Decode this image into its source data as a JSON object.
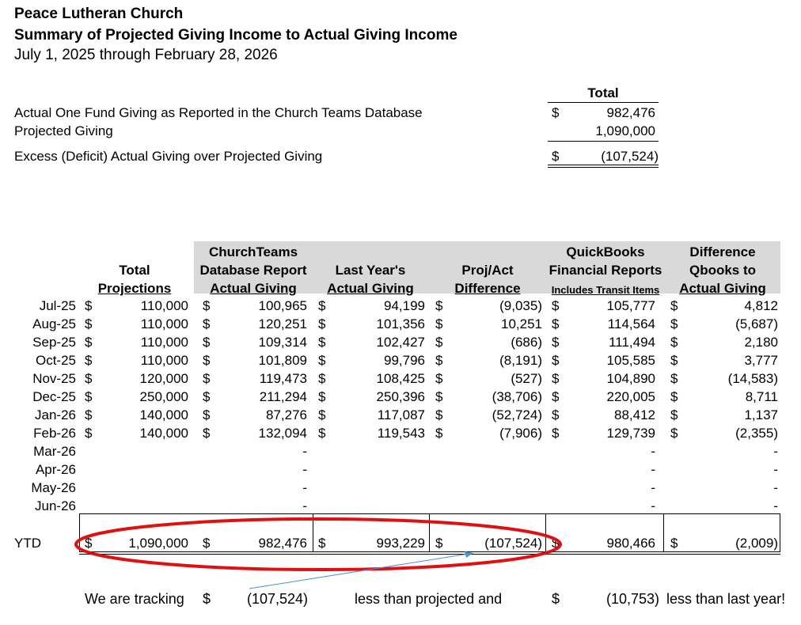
{
  "header": {
    "org": "Peace Lutheran Church",
    "title": "Summary of Projected Giving Income to Actual Giving Income",
    "period": "July 1, 2025 through February 28, 2026"
  },
  "summary": {
    "total_header": "Total",
    "rows": [
      {
        "label": "Actual One Fund Giving as Reported in the Church Teams Database",
        "currency": "$",
        "value": "982,476"
      },
      {
        "label": "Projected Giving",
        "currency": "",
        "value": "1,090,000"
      },
      {
        "label": "Excess (Deficit) Actual Giving over Projected Giving",
        "currency": "$",
        "value": "(107,524)"
      }
    ]
  },
  "table": {
    "headers": {
      "projections": [
        "Total",
        "Projections"
      ],
      "churchteams": [
        "ChurchTeams",
        "Database Report",
        "Actual Giving"
      ],
      "lastyear": [
        "Last Year's",
        "Actual Giving"
      ],
      "projact": [
        "Proj/Act",
        "Difference"
      ],
      "quickbooks": [
        "QuickBooks",
        "Financial Reports",
        "Includes Transit Items"
      ],
      "difference": [
        "Difference",
        "Qbooks to",
        "Actual Giving"
      ]
    },
    "rows": [
      {
        "month": "Jul-25",
        "proj": "110,000",
        "ct": "100,965",
        "ly": "94,199",
        "pa": "(9,035)",
        "qb": "105,777",
        "diff": "4,812"
      },
      {
        "month": "Aug-25",
        "proj": "110,000",
        "ct": "120,251",
        "ly": "101,356",
        "pa": "10,251",
        "qb": "114,564",
        "diff": "(5,687)"
      },
      {
        "month": "Sep-25",
        "proj": "110,000",
        "ct": "109,314",
        "ly": "102,427",
        "pa": "(686)",
        "qb": "111,494",
        "diff": "2,180"
      },
      {
        "month": "Oct-25",
        "proj": "110,000",
        "ct": "101,809",
        "ly": "99,796",
        "pa": "(8,191)",
        "qb": "105,585",
        "diff": "3,777"
      },
      {
        "month": "Nov-25",
        "proj": "120,000",
        "ct": "119,473",
        "ly": "108,425",
        "pa": "(527)",
        "qb": "104,890",
        "diff": "(14,583)"
      },
      {
        "month": "Dec-25",
        "proj": "250,000",
        "ct": "211,294",
        "ly": "250,396",
        "pa": "(38,706)",
        "qb": "220,005",
        "diff": "8,711"
      },
      {
        "month": "Jan-26",
        "proj": "140,000",
        "ct": "87,276",
        "ly": "117,087",
        "pa": "(52,724)",
        "qb": "88,412",
        "diff": "1,137"
      },
      {
        "month": "Feb-26",
        "proj": "140,000",
        "ct": "132,094",
        "ly": "119,543",
        "pa": "(7,906)",
        "qb": "129,739",
        "diff": "(2,355)"
      },
      {
        "month": "Mar-26",
        "proj": "",
        "ct": "-",
        "ly": "",
        "pa": "",
        "qb": "-",
        "diff": "-"
      },
      {
        "month": "Apr-26",
        "proj": "",
        "ct": "-",
        "ly": "",
        "pa": "",
        "qb": "-",
        "diff": "-"
      },
      {
        "month": "May-26",
        "proj": "",
        "ct": "-",
        "ly": "",
        "pa": "",
        "qb": "-",
        "diff": "-"
      },
      {
        "month": "Jun-26",
        "proj": "",
        "ct": "-",
        "ly": "",
        "pa": "",
        "qb": "-",
        "diff": "-"
      }
    ],
    "ytd": {
      "label": "YTD",
      "proj": "1,090,000",
      "ct": "982,476",
      "ly": "993,229",
      "pa": "(107,524)",
      "qb": "980,466",
      "diff": "(2,009)"
    },
    "currency": "$"
  },
  "footer": {
    "tracking": "We are tracking",
    "currency": "$",
    "amount1": "(107,524)",
    "less_projected": "less than projected and",
    "amount2": "(10,753)",
    "less_last_year": "less than last year!"
  },
  "colors": {
    "highlight_ellipse": "#e01010",
    "arrow": "#4a8fd4",
    "header_bg": "#d9d9d9"
  }
}
